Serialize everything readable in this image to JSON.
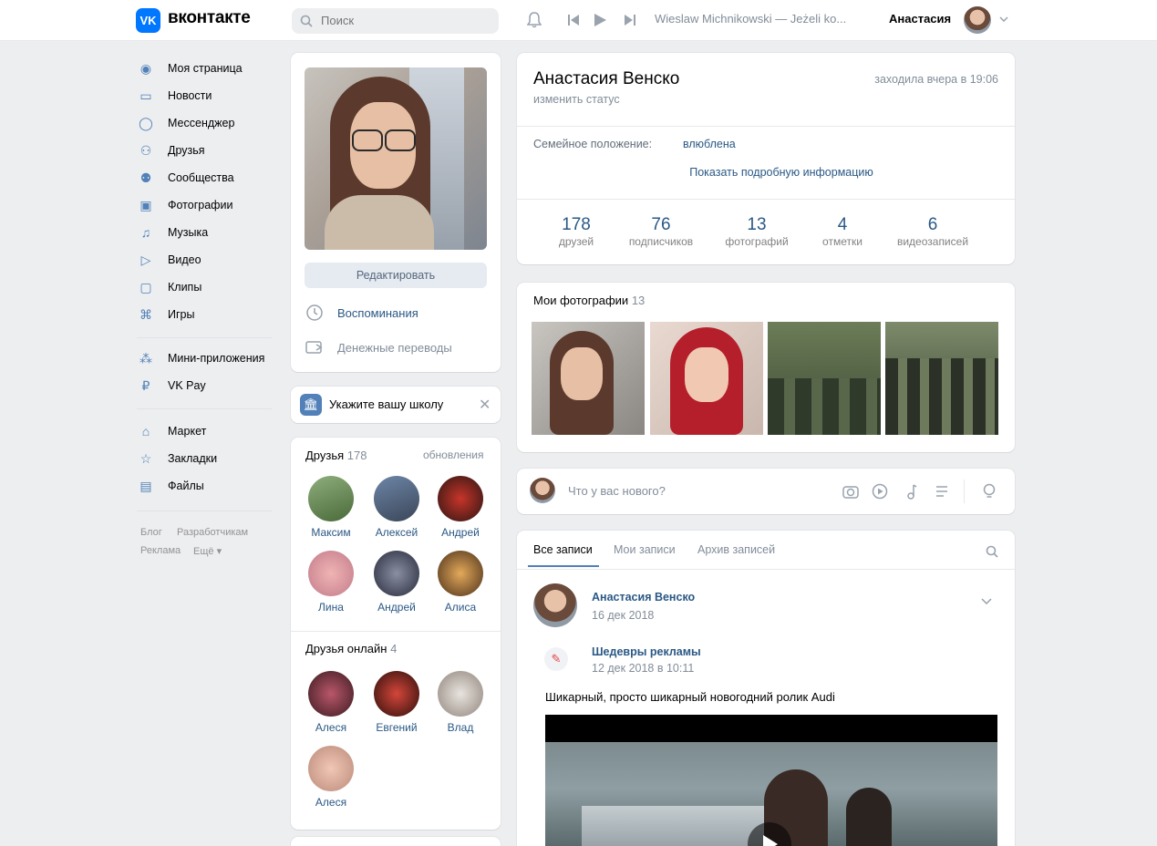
{
  "header": {
    "logo_mark": "VK",
    "logo_text": "вконтакте",
    "search_placeholder": "Поиск",
    "track": "Wieslaw Michnikowski — Jeżeli ko...",
    "user_name": "Анастасия"
  },
  "left_menu": {
    "items": [
      {
        "label": "Моя страница",
        "icon": "user-icon"
      },
      {
        "label": "Новости",
        "icon": "news-icon"
      },
      {
        "label": "Мессенджер",
        "icon": "message-icon"
      },
      {
        "label": "Друзья",
        "icon": "friends-icon"
      },
      {
        "label": "Сообщества",
        "icon": "groups-icon"
      },
      {
        "label": "Фотографии",
        "icon": "photo-icon"
      },
      {
        "label": "Музыка",
        "icon": "music-icon"
      },
      {
        "label": "Видео",
        "icon": "video-icon"
      },
      {
        "label": "Клипы",
        "icon": "clips-icon"
      },
      {
        "label": "Игры",
        "icon": "games-icon"
      }
    ],
    "apps": [
      {
        "label": "Мини-приложения",
        "icon": "apps-icon"
      },
      {
        "label": "VK Pay",
        "icon": "vkpay-icon"
      }
    ],
    "extra": [
      {
        "label": "Маркет",
        "icon": "market-icon"
      },
      {
        "label": "Закладки",
        "icon": "bookmark-icon"
      },
      {
        "label": "Файлы",
        "icon": "files-icon"
      }
    ],
    "footer": {
      "blog": "Блог",
      "dev": "Разработчикам",
      "ads": "Реклама",
      "more": "Ещё"
    }
  },
  "avatar_card": {
    "edit_button": "Редактировать",
    "memories": "Воспоминания",
    "transfers": "Денежные переводы"
  },
  "school_card": {
    "text": "Укажите вашу школу"
  },
  "friends_block": {
    "title": "Друзья",
    "count": "178",
    "updates": "обновления",
    "friends": [
      "Максим",
      "Алексей",
      "Андрей",
      "Лина",
      "Андрей",
      "Алиса"
    ]
  },
  "friends_online": {
    "title": "Друзья онлайн",
    "count": "4",
    "friends": [
      "Алеся",
      "Евгений",
      "Влад",
      "Алеся"
    ]
  },
  "profile": {
    "name": "Анастасия Венско",
    "last_seen": "заходила вчера в 19:06",
    "status_link": "изменить статус",
    "family_label": "Семейное положение:",
    "family_value": "влюблена",
    "details_button": "Показать подробную информацию",
    "stats": [
      {
        "num": "178",
        "label": "друзей"
      },
      {
        "num": "76",
        "label": "подписчиков"
      },
      {
        "num": "13",
        "label": "фотографий"
      },
      {
        "num": "4",
        "label": "отметки"
      },
      {
        "num": "6",
        "label": "видеозаписей"
      }
    ]
  },
  "photos": {
    "title": "Мои фотографии",
    "count": "13"
  },
  "composer": {
    "placeholder": "Что у вас нового?"
  },
  "wall": {
    "tabs": [
      "Все записи",
      "Мои записи",
      "Архив записей"
    ],
    "post_author": "Анастасия Венско",
    "post_date": "16 дек 2018",
    "repost_author": "Шедевры рекламы",
    "repost_date": "12 дек 2018 в 10:11",
    "post_text": "Шикарный, просто шикарный новогодний ролик Audi"
  }
}
